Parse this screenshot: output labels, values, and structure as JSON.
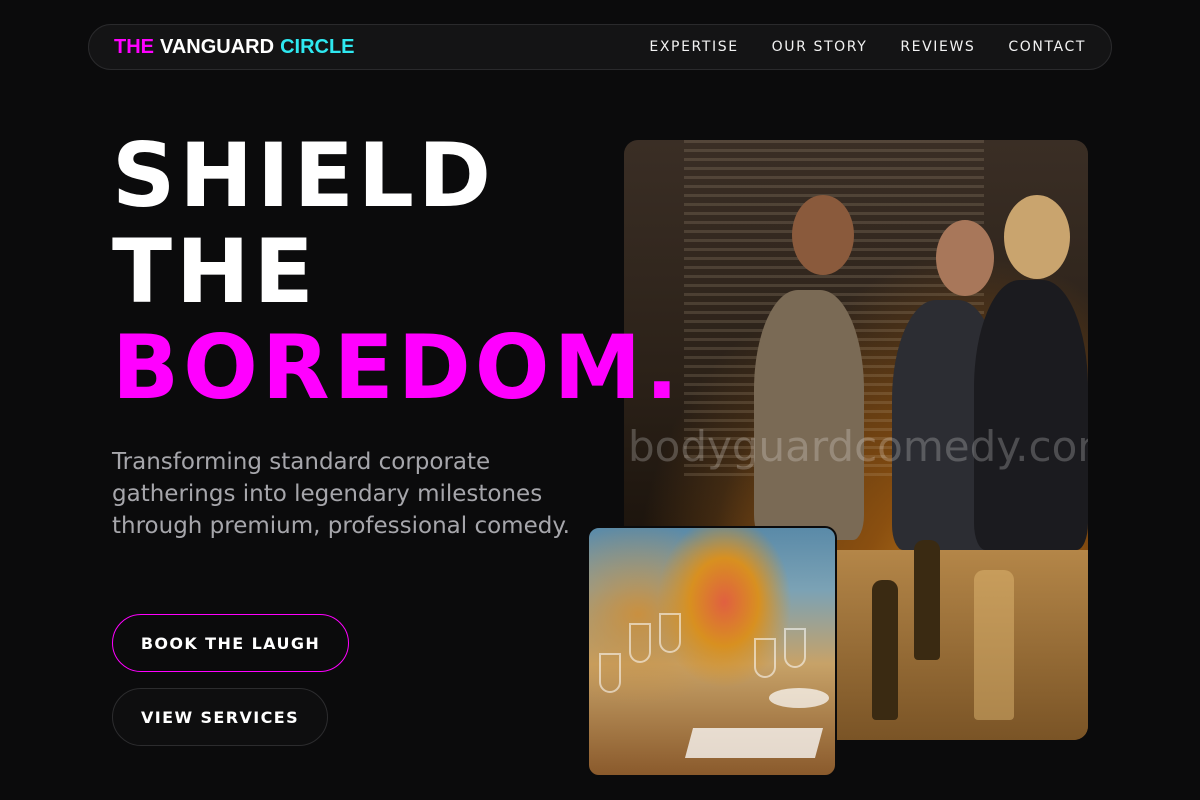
{
  "nav": {
    "logo": {
      "part1": "THE",
      "part2": "VANGUARD",
      "part3": "CIRCLE"
    },
    "links": [
      "EXPERTISE",
      "OUR STORY",
      "REVIEWS",
      "CONTACT"
    ]
  },
  "hero": {
    "headline": [
      "SHIELD",
      "THE",
      "BOREDOM."
    ],
    "subtext": "Transforming standard corporate gatherings into legendary milestones through premium, professional comedy.",
    "primary_cta": "BOOK THE LAUGH",
    "secondary_cta": "VIEW SERVICES"
  },
  "images": {
    "main_watermark": "bodyguardcomedy.com"
  },
  "colors": {
    "accent_magenta": "#ff00ff",
    "accent_cyan": "#2ee8f0",
    "background": "#0b0b0c"
  }
}
